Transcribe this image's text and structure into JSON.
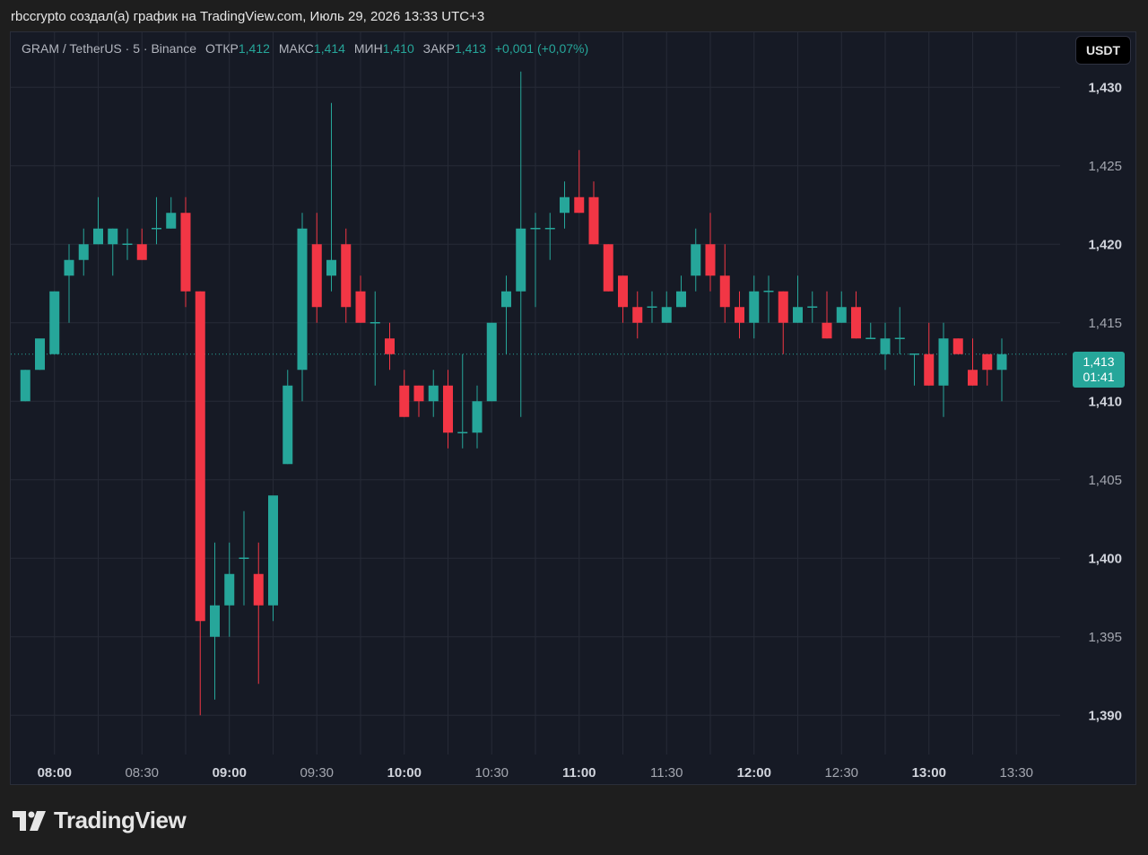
{
  "attribution": "rbccrypto создал(а) график на TradingView.com, Июль 29, 2026 13:33 UTC+3",
  "legend": {
    "symbol": "GRAM / TetherUS · 5 · Binance",
    "open_label": "ОТКР",
    "open": "1,412",
    "high_label": "МАКС",
    "high": "1,414",
    "low_label": "МИН",
    "low": "1,410",
    "close_label": "ЗАКР",
    "close": "1,413",
    "change": "+0,001 (+0,07%)"
  },
  "currency_button": "USDT",
  "price_tag": {
    "price": "1,413",
    "countdown": "01:41"
  },
  "logo_text": "TradingView",
  "colors": {
    "up": "#26a69a",
    "down": "#f23645",
    "background": "#161a25",
    "grid": "#262a36"
  },
  "chart_data": {
    "type": "candlestick",
    "interval_minutes": 5,
    "x_start": "07:50",
    "xlim": [
      "07:45",
      "13:45"
    ],
    "ylim": [
      1.3875,
      1.4335
    ],
    "y_ticks": [
      {
        "value": 1.43,
        "label": "1,430",
        "bold": true
      },
      {
        "value": 1.425,
        "label": "1,425",
        "bold": false
      },
      {
        "value": 1.42,
        "label": "1,420",
        "bold": true
      },
      {
        "value": 1.415,
        "label": "1,415",
        "bold": false
      },
      {
        "value": 1.41,
        "label": "1,410",
        "bold": true
      },
      {
        "value": 1.405,
        "label": "1,405",
        "bold": false
      },
      {
        "value": 1.4,
        "label": "1,400",
        "bold": true
      },
      {
        "value": 1.395,
        "label": "1,395",
        "bold": false
      },
      {
        "value": 1.39,
        "label": "1,390",
        "bold": true
      }
    ],
    "x_ticks": [
      {
        "time": "08:00",
        "label": "08:00",
        "bold": true
      },
      {
        "time": "08:30",
        "label": "08:30",
        "bold": false
      },
      {
        "time": "09:00",
        "label": "09:00",
        "bold": true
      },
      {
        "time": "09:30",
        "label": "09:30",
        "bold": false
      },
      {
        "time": "10:00",
        "label": "10:00",
        "bold": true
      },
      {
        "time": "10:30",
        "label": "10:30",
        "bold": false
      },
      {
        "time": "11:00",
        "label": "11:00",
        "bold": true
      },
      {
        "time": "11:30",
        "label": "11:30",
        "bold": false
      },
      {
        "time": "12:00",
        "label": "12:00",
        "bold": true
      },
      {
        "time": "12:30",
        "label": "12:30",
        "bold": false
      },
      {
        "time": "13:00",
        "label": "13:00",
        "bold": true
      },
      {
        "time": "13:30",
        "label": "13:30",
        "bold": false
      }
    ],
    "last_price": 1.413,
    "candles": [
      [
        1.41,
        1.412,
        1.41,
        1.412
      ],
      [
        1.412,
        1.413,
        1.412,
        1.414
      ],
      [
        1.413,
        1.417,
        1.413,
        1.417
      ],
      [
        1.418,
        1.42,
        1.415,
        1.419
      ],
      [
        1.419,
        1.421,
        1.418,
        1.42
      ],
      [
        1.42,
        1.423,
        1.42,
        1.421
      ],
      [
        1.42,
        1.421,
        1.418,
        1.421
      ],
      [
        1.42,
        1.421,
        1.419,
        1.42
      ],
      [
        1.42,
        1.421,
        1.419,
        1.419
      ],
      [
        1.421,
        1.423,
        1.42,
        1.421
      ],
      [
        1.421,
        1.423,
        1.421,
        1.422
      ],
      [
        1.422,
        1.423,
        1.416,
        1.417
      ],
      [
        1.417,
        1.417,
        1.39,
        1.396
      ],
      [
        1.395,
        1.401,
        1.391,
        1.397
      ],
      [
        1.397,
        1.401,
        1.395,
        1.399
      ],
      [
        1.4,
        1.403,
        1.397,
        1.4
      ],
      [
        1.399,
        1.401,
        1.392,
        1.397
      ],
      [
        1.397,
        1.4,
        1.396,
        1.404
      ],
      [
        1.406,
        1.412,
        1.406,
        1.411
      ],
      [
        1.412,
        1.422,
        1.41,
        1.421
      ],
      [
        1.42,
        1.422,
        1.415,
        1.416
      ],
      [
        1.418,
        1.429,
        1.417,
        1.419
      ],
      [
        1.42,
        1.421,
        1.415,
        1.416
      ],
      [
        1.417,
        1.418,
        1.415,
        1.415
      ],
      [
        1.415,
        1.417,
        1.411,
        1.415
      ],
      [
        1.414,
        1.415,
        1.412,
        1.413
      ],
      [
        1.411,
        1.412,
        1.409,
        1.409
      ],
      [
        1.411,
        1.411,
        1.409,
        1.41
      ],
      [
        1.41,
        1.412,
        1.409,
        1.411
      ],
      [
        1.411,
        1.412,
        1.407,
        1.408
      ],
      [
        1.408,
        1.413,
        1.407,
        1.408
      ],
      [
        1.408,
        1.411,
        1.407,
        1.41
      ],
      [
        1.41,
        1.415,
        1.41,
        1.415
      ],
      [
        1.416,
        1.418,
        1.413,
        1.417
      ],
      [
        1.417,
        1.431,
        1.409,
        1.421
      ],
      [
        1.421,
        1.422,
        1.416,
        1.421
      ],
      [
        1.421,
        1.422,
        1.419,
        1.421
      ],
      [
        1.422,
        1.424,
        1.421,
        1.423
      ],
      [
        1.423,
        1.426,
        1.422,
        1.422
      ],
      [
        1.423,
        1.424,
        1.42,
        1.42
      ],
      [
        1.42,
        1.42,
        1.417,
        1.417
      ],
      [
        1.418,
        1.418,
        1.415,
        1.416
      ],
      [
        1.416,
        1.417,
        1.414,
        1.415
      ],
      [
        1.416,
        1.417,
        1.415,
        1.416
      ],
      [
        1.415,
        1.417,
        1.415,
        1.416
      ],
      [
        1.416,
        1.418,
        1.416,
        1.417
      ],
      [
        1.418,
        1.421,
        1.417,
        1.42
      ],
      [
        1.42,
        1.422,
        1.417,
        1.418
      ],
      [
        1.418,
        1.42,
        1.415,
        1.416
      ],
      [
        1.416,
        1.417,
        1.414,
        1.415
      ],
      [
        1.415,
        1.418,
        1.414,
        1.417
      ],
      [
        1.417,
        1.418,
        1.415,
        1.417
      ],
      [
        1.417,
        1.417,
        1.413,
        1.415
      ],
      [
        1.415,
        1.418,
        1.415,
        1.416
      ],
      [
        1.416,
        1.417,
        1.415,
        1.416
      ],
      [
        1.415,
        1.417,
        1.414,
        1.414
      ],
      [
        1.415,
        1.417,
        1.415,
        1.416
      ],
      [
        1.416,
        1.417,
        1.414,
        1.414
      ],
      [
        1.414,
        1.415,
        1.414,
        1.414
      ],
      [
        1.413,
        1.415,
        1.412,
        1.414
      ],
      [
        1.414,
        1.416,
        1.413,
        1.414
      ],
      [
        1.413,
        1.413,
        1.411,
        1.413
      ],
      [
        1.413,
        1.415,
        1.411,
        1.411
      ],
      [
        1.411,
        1.415,
        1.409,
        1.414
      ],
      [
        1.414,
        1.414,
        1.413,
        1.413
      ],
      [
        1.412,
        1.414,
        1.411,
        1.411
      ],
      [
        1.413,
        1.413,
        1.411,
        1.412
      ],
      [
        1.412,
        1.414,
        1.41,
        1.413
      ]
    ]
  }
}
